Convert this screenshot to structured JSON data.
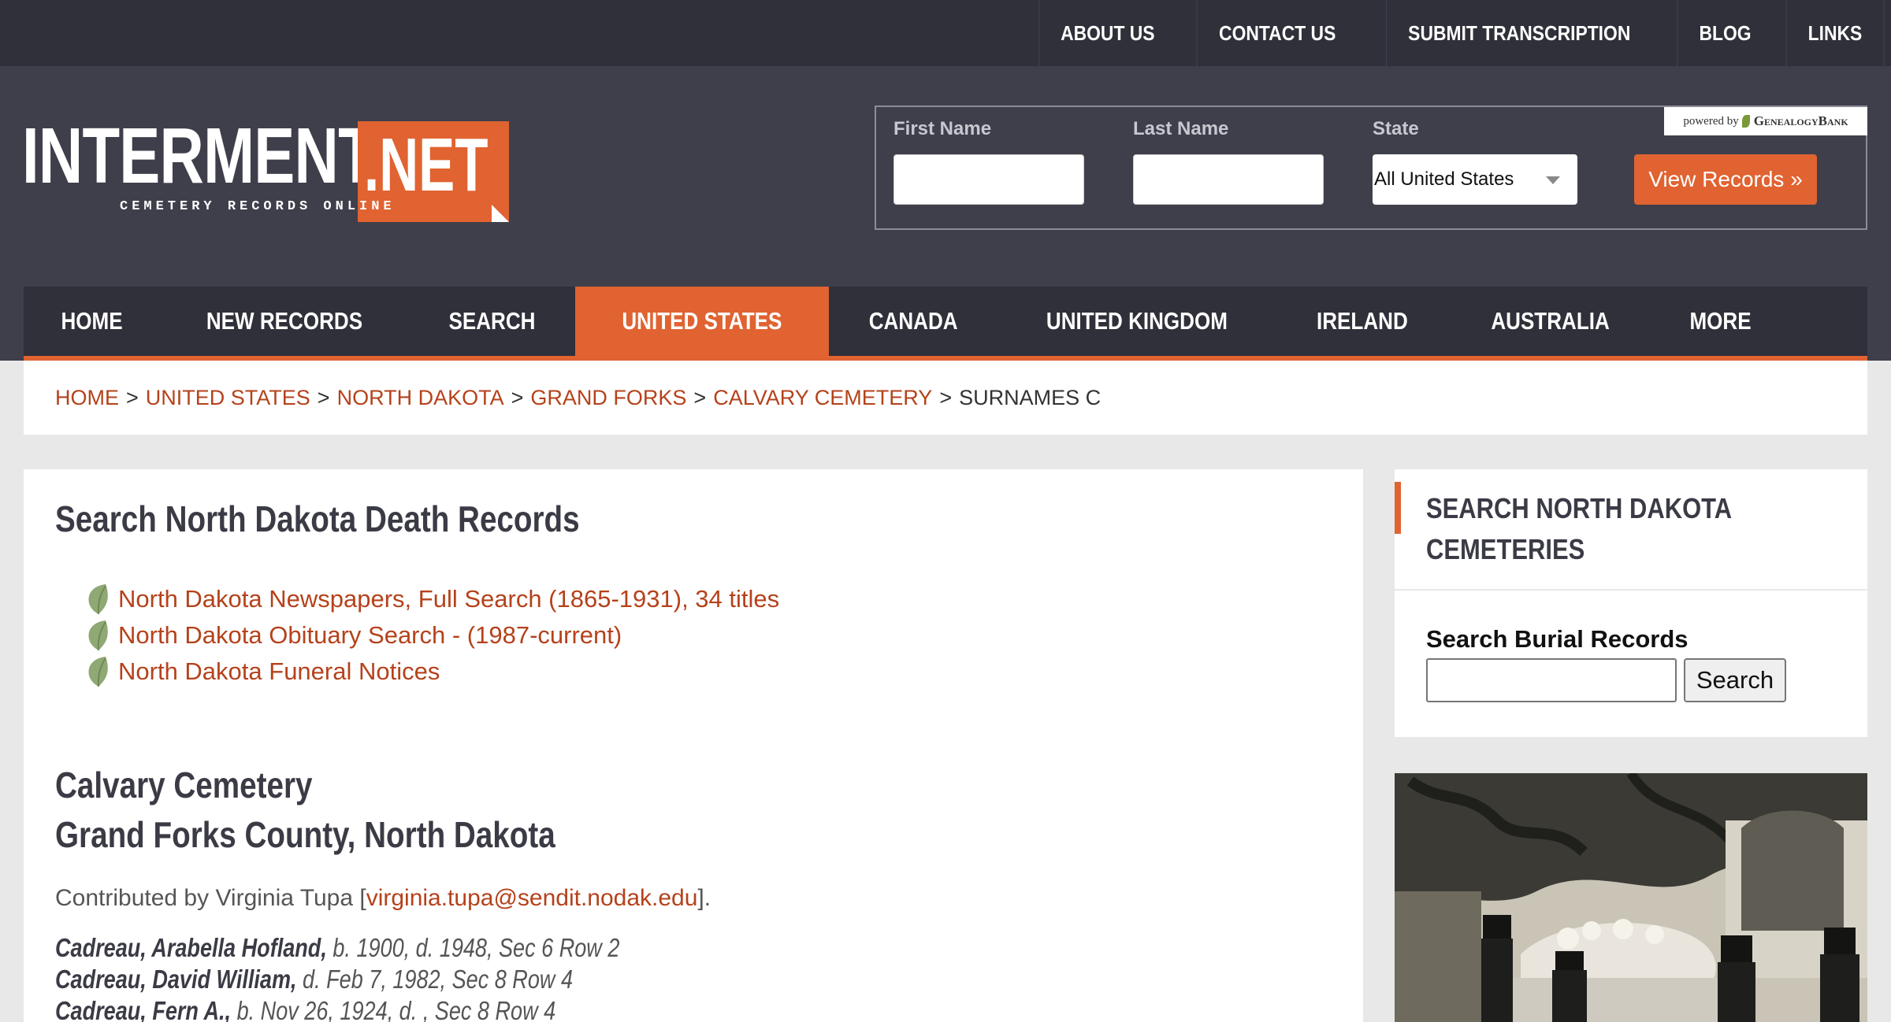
{
  "top_nav": [
    "ABOUT US",
    "CONTACT US",
    "SUBMIT TRANSCRIPTION",
    "BLOG",
    "LINKS"
  ],
  "logo": {
    "main": "INTERMENT",
    "box": ".NET",
    "tagline": "CEMETERY RECORDS ONLINE"
  },
  "search": {
    "first_name_label": "First Name",
    "last_name_label": "Last Name",
    "state_label": "State",
    "state_value": "All United States",
    "button": "View Records »",
    "powered_by": "powered by",
    "powered_brand": "GenealogyBank"
  },
  "main_nav": [
    "HOME",
    "NEW RECORDS",
    "SEARCH",
    "UNITED STATES",
    "CANADA",
    "UNITED KINGDOM",
    "IRELAND",
    "AUSTRALIA",
    "MORE"
  ],
  "main_nav_active": "UNITED STATES",
  "breadcrumb": {
    "links": [
      "HOME",
      "UNITED STATES",
      "NORTH DAKOTA",
      "GRAND FORKS",
      "CALVARY CEMETERY"
    ],
    "current": "SURNAMES C",
    "separator": ">"
  },
  "content": {
    "search_heading": "Search North Dakota Death Records",
    "links": [
      "North Dakota Newspapers, Full Search (1865-1931), 34 titles",
      "North Dakota Obituary Search - (1987-current)",
      "North Dakota Funeral Notices"
    ],
    "cemetery_name": "Calvary Cemetery",
    "county": "Grand Forks County, North Dakota",
    "contributed_prefix": "Contributed by Virginia Tupa [",
    "contributed_email": "virginia.tupa@sendit.nodak.edu",
    "contributed_suffix": "].",
    "records": [
      {
        "name": "Cadreau, Arabella Hofland,",
        "details": " b. 1900, d. 1948, Sec 6 Row 2"
      },
      {
        "name": "Cadreau, David William,",
        "details": " d. Feb 7, 1982, Sec 8 Row 4"
      },
      {
        "name": "Cadreau, Fern A.,",
        "details": " b. Nov 26, 1924, d. , Sec 8 Row 4"
      }
    ]
  },
  "sidebar": {
    "heading": "SEARCH NORTH DAKOTA CEMETERIES",
    "search_label": "Search Burial Records",
    "search_button": "Search"
  },
  "colors": {
    "accent": "#e06331",
    "link": "#b5421b",
    "dark": "#2f3039",
    "header": "#3e3f4b"
  }
}
